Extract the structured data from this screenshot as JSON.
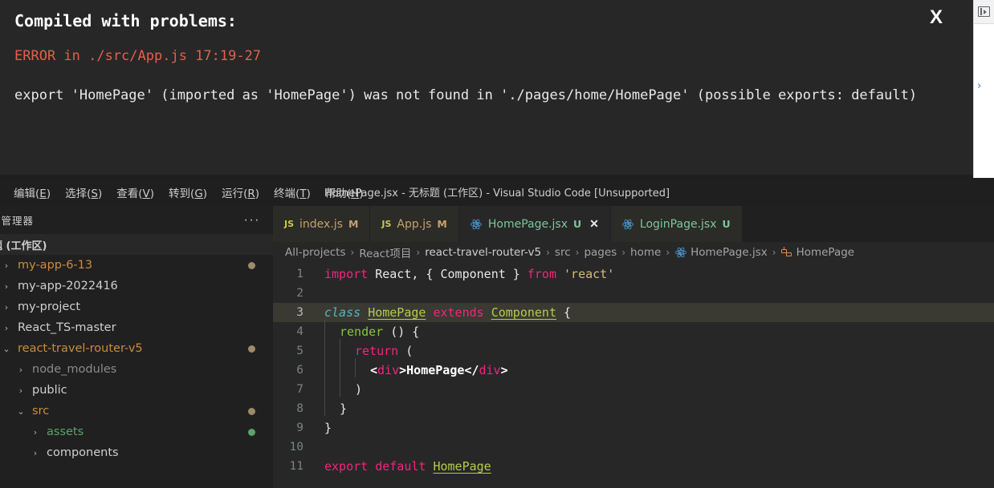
{
  "error_overlay": {
    "title": "Compiled with problems:",
    "heading": "ERROR in ./src/App.js 17:19-27",
    "body": "export 'HomePage' (imported as 'HomePage') was not found in './pages/home/HomePage' (possible exports: default)",
    "close_label": "X",
    "bg_color": "#272727",
    "error_color": "#e3604a"
  },
  "browser_strip": {
    "panel_toggle_icon": "panel-toggle-icon",
    "chevron": "›"
  },
  "titlebar": {
    "title": "HomePage.jsx - 无标题 (工作区) - Visual Studio Code [Unsupported]",
    "menu": [
      {
        "label": "编辑",
        "mnemonic": "E"
      },
      {
        "label": "选择",
        "mnemonic": "S"
      },
      {
        "label": "查看",
        "mnemonic": "V"
      },
      {
        "label": "转到",
        "mnemonic": "G"
      },
      {
        "label": "运行",
        "mnemonic": "R"
      },
      {
        "label": "终端",
        "mnemonic": "T"
      },
      {
        "label": "帮助",
        "mnemonic": "H"
      }
    ]
  },
  "sidebar": {
    "title": "源管理器",
    "more_icon": "···",
    "workspace_header": "题 (工作区)",
    "tree": [
      {
        "label": "my-app-6-13",
        "indent": 0,
        "arrow": "›",
        "expanded": false,
        "color": "#cc8b3c",
        "dot": "#9d8b6b"
      },
      {
        "label": "my-app-2022416",
        "indent": 0,
        "arrow": "›",
        "expanded": false,
        "color": "#cfcfcf",
        "dot": ""
      },
      {
        "label": "my-project",
        "indent": 0,
        "arrow": "›",
        "expanded": false,
        "color": "#cfcfcf",
        "dot": ""
      },
      {
        "label": "React_TS-master",
        "indent": 0,
        "arrow": "›",
        "expanded": false,
        "color": "#cfcfcf",
        "dot": ""
      },
      {
        "label": "react-travel-router-v5",
        "indent": 0,
        "arrow": "⌄",
        "expanded": true,
        "color": "#cc8b3c",
        "dot": "#9d8b6b"
      },
      {
        "label": "node_modules",
        "indent": 1,
        "arrow": "›",
        "expanded": false,
        "color": "#8a8a8a",
        "dot": ""
      },
      {
        "label": "public",
        "indent": 1,
        "arrow": "›",
        "expanded": false,
        "color": "#cfcfcf",
        "dot": ""
      },
      {
        "label": "src",
        "indent": 1,
        "arrow": "⌄",
        "expanded": true,
        "color": "#cc8b3c",
        "dot": "#9d8b6b"
      },
      {
        "label": "assets",
        "indent": 2,
        "arrow": "›",
        "expanded": false,
        "color": "#5aa36a",
        "dot": "#5aa36a"
      },
      {
        "label": "components",
        "indent": 2,
        "arrow": "›",
        "expanded": false,
        "color": "#cfcfcf",
        "dot": ""
      }
    ]
  },
  "tabs": [
    {
      "name": "index.js",
      "icon": "js",
      "badge": "M",
      "badge_kind": "m",
      "name_kind": "js",
      "active": false,
      "closable": false
    },
    {
      "name": "App.js",
      "icon": "js",
      "badge": "M",
      "badge_kind": "m",
      "name_kind": "js",
      "active": false,
      "closable": false
    },
    {
      "name": "HomePage.jsx",
      "icon": "react",
      "badge": "U",
      "badge_kind": "u",
      "name_kind": "jsx",
      "active": true,
      "closable": true,
      "close_label": "✕"
    },
    {
      "name": "LoginPage.jsx",
      "icon": "react",
      "badge": "U",
      "badge_kind": "u",
      "name_kind": "jsx",
      "active": false,
      "closable": false
    }
  ],
  "breadcrumb": {
    "separator": "›",
    "items": [
      {
        "label": "All-projects",
        "icon": "",
        "bold": false
      },
      {
        "label": "React项目",
        "icon": "",
        "bold": false
      },
      {
        "label": "react-travel-router-v5",
        "icon": "",
        "bold": true
      },
      {
        "label": "src",
        "icon": "",
        "bold": false
      },
      {
        "label": "pages",
        "icon": "",
        "bold": false
      },
      {
        "label": "home",
        "icon": "",
        "bold": false
      },
      {
        "label": "HomePage.jsx",
        "icon": "react",
        "bold": false
      },
      {
        "label": "HomePage",
        "icon": "class",
        "bold": false
      }
    ]
  },
  "code": {
    "language": "jsx",
    "current_line": 3,
    "lines": [
      {
        "n": 1,
        "indent": 0,
        "guides": 0,
        "tokens": [
          {
            "t": "import ",
            "c": "k-key"
          },
          {
            "t": "React",
            "c": "k-plain"
          },
          {
            "t": ", { ",
            "c": "k-punct"
          },
          {
            "t": "Component",
            "c": "k-plain"
          },
          {
            "t": " } ",
            "c": "k-punct"
          },
          {
            "t": "from ",
            "c": "k-key"
          },
          {
            "t": "'react'",
            "c": "k-str"
          }
        ]
      },
      {
        "n": 2,
        "indent": 0,
        "guides": 0,
        "tokens": []
      },
      {
        "n": 3,
        "indent": 0,
        "guides": 0,
        "tokens": [
          {
            "t": "class ",
            "c": "k-ctrl"
          },
          {
            "t": "HomePage",
            "c": "k-class"
          },
          {
            "t": " ",
            "c": "k-plain"
          },
          {
            "t": "extends",
            "c": "k-key"
          },
          {
            "t": " ",
            "c": "k-plain"
          },
          {
            "t": "Component",
            "c": "k-class"
          },
          {
            "t": " {",
            "c": "k-punct"
          }
        ]
      },
      {
        "n": 4,
        "indent": 1,
        "guides": 1,
        "tokens": [
          {
            "t": "render",
            "c": "k-fn"
          },
          {
            "t": " () {",
            "c": "k-punct"
          }
        ]
      },
      {
        "n": 5,
        "indent": 2,
        "guides": 2,
        "tokens": [
          {
            "t": "return",
            "c": "k-key"
          },
          {
            "t": " (",
            "c": "k-punct"
          }
        ]
      },
      {
        "n": 6,
        "indent": 3,
        "guides": 3,
        "tokens": [
          {
            "t": "<",
            "c": "k-tagtext"
          },
          {
            "t": "div",
            "c": "k-tag"
          },
          {
            "t": ">",
            "c": "k-tagtext"
          },
          {
            "t": "HomePage",
            "c": "k-tagtext"
          },
          {
            "t": "</",
            "c": "k-tagtext"
          },
          {
            "t": "div",
            "c": "k-tag"
          },
          {
            "t": ">",
            "c": "k-tagtext"
          }
        ]
      },
      {
        "n": 7,
        "indent": 2,
        "guides": 2,
        "tokens": [
          {
            "t": ")",
            "c": "k-punct"
          }
        ]
      },
      {
        "n": 8,
        "indent": 1,
        "guides": 1,
        "tokens": [
          {
            "t": "}",
            "c": "k-punct"
          }
        ]
      },
      {
        "n": 9,
        "indent": 0,
        "guides": 0,
        "tokens": [
          {
            "t": "}",
            "c": "k-punct"
          }
        ]
      },
      {
        "n": 10,
        "indent": 0,
        "guides": 0,
        "tokens": []
      },
      {
        "n": 11,
        "indent": 0,
        "guides": 0,
        "tokens": [
          {
            "t": "export default ",
            "c": "k-key"
          },
          {
            "t": "HomePage",
            "c": "k-class"
          }
        ]
      }
    ]
  }
}
